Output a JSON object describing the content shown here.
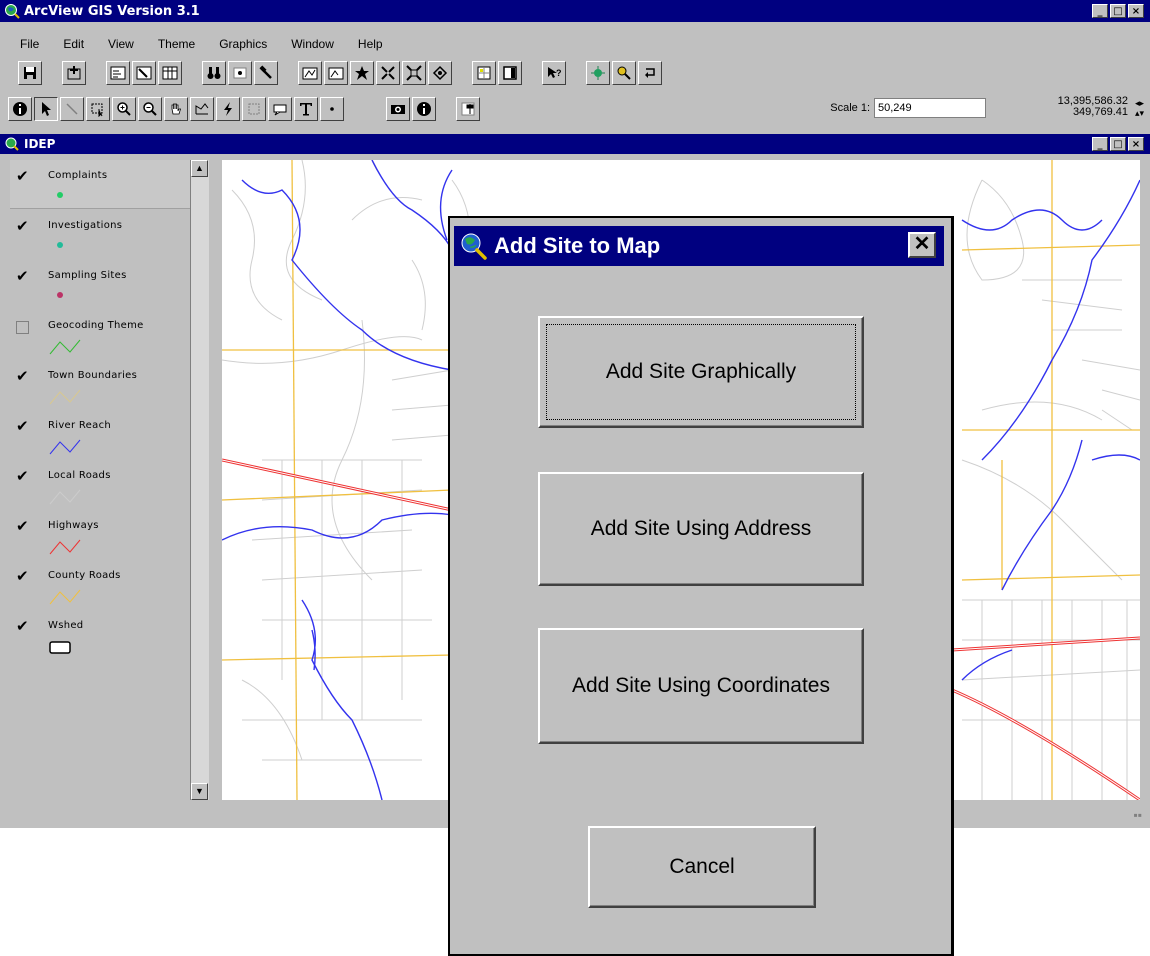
{
  "app": {
    "title": "ArcView GIS Version 3.1",
    "window_buttons": [
      "_",
      "□",
      "×"
    ]
  },
  "menu": [
    "File",
    "Edit",
    "View",
    "Theme",
    "Graphics",
    "Window",
    "Help"
  ],
  "toolbar2": {
    "scale_label": "Scale 1:",
    "scale_value": "50,249",
    "coord_x": "13,395,586.32",
    "coord_y": "349,769.41"
  },
  "view": {
    "title": "IDEP",
    "layers": [
      {
        "name": "Complaints",
        "checked": true
      },
      {
        "name": "Investigations",
        "checked": true
      },
      {
        "name": "Sampling Sites",
        "checked": true
      },
      {
        "name": "Geocoding Theme",
        "checked": false
      },
      {
        "name": "Town Boundaries",
        "checked": true
      },
      {
        "name": "River Reach",
        "checked": true
      },
      {
        "name": "Local Roads",
        "checked": true
      },
      {
        "name": "Highways",
        "checked": true
      },
      {
        "name": "County Roads",
        "checked": true
      },
      {
        "name": "Wshed",
        "checked": true
      }
    ]
  },
  "colors": {
    "titlebar": "#000080",
    "face": "#c0c0c0",
    "river": "#3333ee",
    "county_roads": "#f0c040",
    "highways": "#ee3333",
    "local_roads": "#c8c8c8",
    "complaints_dot": "#22cc66",
    "investigations_dot": "#22bb99",
    "sampling_dot": "#bb3366"
  },
  "dialog": {
    "title": "Add Site to Map",
    "close": "✕",
    "btn_graphically": "Add Site Graphically",
    "btn_address": "Add Site Using Address",
    "btn_coordinates": "Add Site Using Coordinates",
    "btn_cancel": "Cancel"
  }
}
